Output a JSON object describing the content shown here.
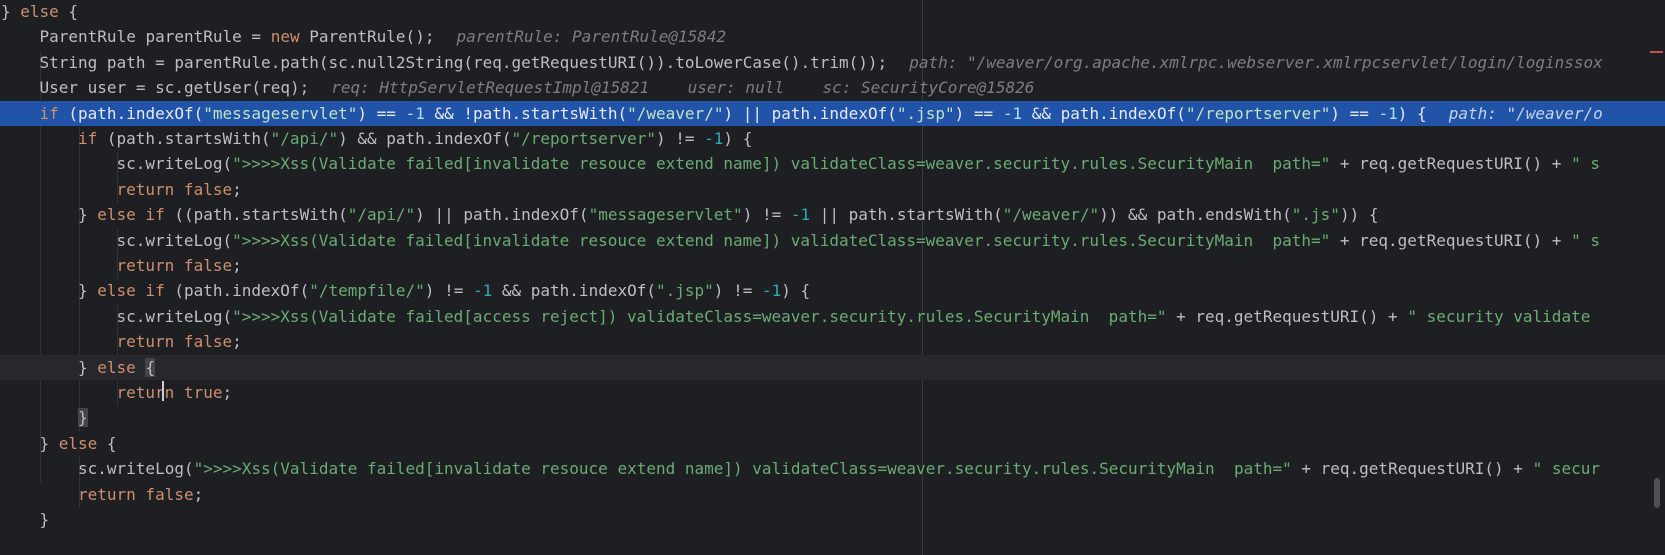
{
  "editor": {
    "lines": [
      {
        "kind": "normal",
        "indent": 0,
        "segs": [
          {
            "c": "t",
            "v": "} "
          },
          {
            "c": "kw",
            "v": "else"
          },
          {
            "c": "t",
            "v": " {"
          }
        ]
      },
      {
        "kind": "normal",
        "indent": 1,
        "segs": [
          {
            "c": "t",
            "v": "ParentRule parentRule = "
          },
          {
            "c": "kw",
            "v": "new"
          },
          {
            "c": "t",
            "v": " ParentRule();"
          }
        ],
        "hint": "parentRule: ParentRule@15842"
      },
      {
        "kind": "normal",
        "indent": 1,
        "segs": [
          {
            "c": "t",
            "v": "String path = parentRule.path(sc.null2String(req.getRequestURI()).toLowerCase().trim());"
          }
        ],
        "hint": "path: \"/weaver/org.apache.xmlrpc.webserver.xmlrpcservlet/login/loginssox"
      },
      {
        "kind": "normal",
        "indent": 1,
        "segs": [
          {
            "c": "t",
            "v": "User user = sc.getUser(req);"
          }
        ],
        "hint": "req: HttpServletRequestImpl@15821    user: null    sc: SecurityCore@15826"
      },
      {
        "kind": "exec",
        "indent": 1,
        "segs": [
          {
            "c": "kw",
            "v": "if"
          },
          {
            "c": "t",
            "v": " (path.indexOf("
          },
          {
            "c": "str",
            "v": "\"messageservlet\""
          },
          {
            "c": "t",
            "v": ") == "
          },
          {
            "c": "num",
            "v": "-1"
          },
          {
            "c": "t",
            "v": " && !path.startsWith("
          },
          {
            "c": "str",
            "v": "\"/weaver/\""
          },
          {
            "c": "t",
            "v": ") || path.indexOf("
          },
          {
            "c": "str",
            "v": "\".jsp\""
          },
          {
            "c": "t",
            "v": ") == "
          },
          {
            "c": "num",
            "v": "-1"
          },
          {
            "c": "t",
            "v": " && path.indexOf("
          },
          {
            "c": "str",
            "v": "\"/reportserver\""
          },
          {
            "c": "t",
            "v": ") == "
          },
          {
            "c": "num",
            "v": "-1"
          },
          {
            "c": "t",
            "v": ") {"
          }
        ],
        "hint": "path: \"/weaver/o"
      },
      {
        "kind": "normal",
        "indent": 2,
        "segs": [
          {
            "c": "kw",
            "v": "if"
          },
          {
            "c": "t",
            "v": " (path.startsWith("
          },
          {
            "c": "str",
            "v": "\"/api/\""
          },
          {
            "c": "t",
            "v": ") && path.indexOf("
          },
          {
            "c": "str",
            "v": "\"/reportserver\""
          },
          {
            "c": "t",
            "v": ") != "
          },
          {
            "c": "num",
            "v": "-1"
          },
          {
            "c": "t",
            "v": ") {"
          }
        ]
      },
      {
        "kind": "normal",
        "indent": 3,
        "segs": [
          {
            "c": "t",
            "v": "sc.writeLog("
          },
          {
            "c": "str",
            "v": "\">>>>Xss(Validate failed[invalidate resouce extend name]) validateClass=weaver.security.rules.SecurityMain  path=\""
          },
          {
            "c": "t",
            "v": " + req.getRequestURI() + "
          },
          {
            "c": "str",
            "v": "\" s"
          }
        ]
      },
      {
        "kind": "normal",
        "indent": 3,
        "segs": [
          {
            "c": "kw",
            "v": "return false"
          },
          {
            "c": "t",
            "v": ";"
          }
        ]
      },
      {
        "kind": "normal",
        "indent": 2,
        "segs": [
          {
            "c": "t",
            "v": "} "
          },
          {
            "c": "kw",
            "v": "else if"
          },
          {
            "c": "t",
            "v": " ((path.startsWith("
          },
          {
            "c": "str",
            "v": "\"/api/\""
          },
          {
            "c": "t",
            "v": ") || path.indexOf("
          },
          {
            "c": "str",
            "v": "\"messageservlet\""
          },
          {
            "c": "t",
            "v": ") != "
          },
          {
            "c": "num",
            "v": "-1"
          },
          {
            "c": "t",
            "v": " || path.startsWith("
          },
          {
            "c": "str",
            "v": "\"/weaver/\""
          },
          {
            "c": "t",
            "v": ")) && path.endsWith("
          },
          {
            "c": "str",
            "v": "\".js\""
          },
          {
            "c": "t",
            "v": ")) {"
          }
        ]
      },
      {
        "kind": "normal",
        "indent": 3,
        "segs": [
          {
            "c": "t",
            "v": "sc.writeLog("
          },
          {
            "c": "str",
            "v": "\">>>>Xss(Validate failed[invalidate resouce extend name]) validateClass=weaver.security.rules.SecurityMain  path=\""
          },
          {
            "c": "t",
            "v": " + req.getRequestURI() + "
          },
          {
            "c": "str",
            "v": "\" s"
          }
        ]
      },
      {
        "kind": "normal",
        "indent": 3,
        "segs": [
          {
            "c": "kw",
            "v": "return false"
          },
          {
            "c": "t",
            "v": ";"
          }
        ]
      },
      {
        "kind": "normal",
        "indent": 2,
        "segs": [
          {
            "c": "t",
            "v": "} "
          },
          {
            "c": "kw",
            "v": "else if"
          },
          {
            "c": "t",
            "v": " (path.indexOf("
          },
          {
            "c": "str",
            "v": "\"/tempfile/\""
          },
          {
            "c": "t",
            "v": ") != "
          },
          {
            "c": "num",
            "v": "-1"
          },
          {
            "c": "t",
            "v": " && path.indexOf("
          },
          {
            "c": "str",
            "v": "\".jsp\""
          },
          {
            "c": "t",
            "v": ") != "
          },
          {
            "c": "num",
            "v": "-1"
          },
          {
            "c": "t",
            "v": ") {"
          }
        ]
      },
      {
        "kind": "normal",
        "indent": 3,
        "segs": [
          {
            "c": "t",
            "v": "sc.writeLog("
          },
          {
            "c": "str",
            "v": "\">>>>Xss(Validate failed[access reject]) validateClass=weaver.security.rules.SecurityMain  path=\""
          },
          {
            "c": "t",
            "v": " + req.getRequestURI() + "
          },
          {
            "c": "str",
            "v": "\" security validate"
          }
        ]
      },
      {
        "kind": "normal",
        "indent": 3,
        "segs": [
          {
            "c": "kw",
            "v": "return false"
          },
          {
            "c": "t",
            "v": ";"
          }
        ]
      },
      {
        "kind": "caret",
        "indent": 2,
        "segs": [
          {
            "c": "t",
            "v": "} "
          },
          {
            "c": "kw",
            "v": "else"
          },
          {
            "c": "t",
            "v": " "
          },
          {
            "c": "bm",
            "v": "{"
          }
        ]
      },
      {
        "kind": "normal",
        "indent": 3,
        "segs": [
          {
            "c": "kw",
            "v": "return true"
          },
          {
            "c": "t",
            "v": ";"
          }
        ]
      },
      {
        "kind": "normal",
        "indent": 2,
        "segs": [
          {
            "c": "bm",
            "v": "}"
          }
        ]
      },
      {
        "kind": "normal",
        "indent": 1,
        "segs": [
          {
            "c": "t",
            "v": "} "
          },
          {
            "c": "kw",
            "v": "else"
          },
          {
            "c": "t",
            "v": " {"
          }
        ]
      },
      {
        "kind": "normal",
        "indent": 2,
        "segs": [
          {
            "c": "t",
            "v": "sc.writeLog("
          },
          {
            "c": "str",
            "v": "\">>>>Xss(Validate failed[invalidate resouce extend name]) validateClass=weaver.security.rules.SecurityMain  path=\""
          },
          {
            "c": "t",
            "v": " + req.getRequestURI() + "
          },
          {
            "c": "str",
            "v": "\" secur"
          }
        ]
      },
      {
        "kind": "normal",
        "indent": 2,
        "segs": [
          {
            "c": "kw",
            "v": "return false"
          },
          {
            "c": "t",
            "v": ";"
          }
        ]
      },
      {
        "kind": "normal",
        "indent": 1,
        "segs": [
          {
            "c": "t",
            "v": "}"
          }
        ]
      }
    ]
  }
}
